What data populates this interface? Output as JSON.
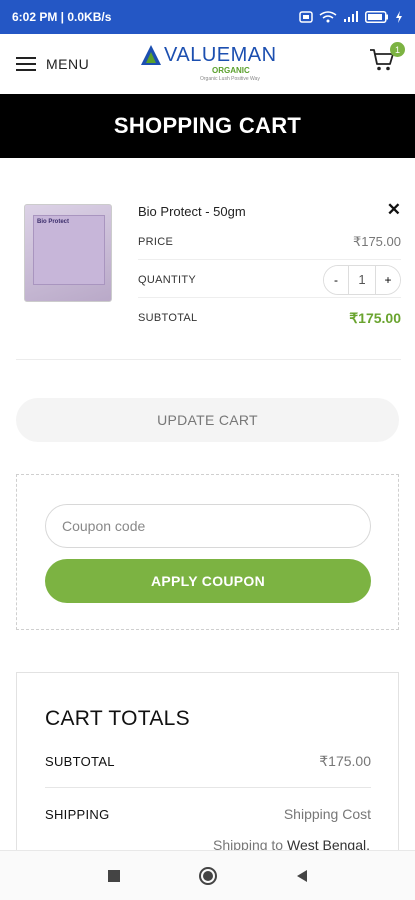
{
  "status_bar": {
    "time": "6:02 PM | 0.0KB/s",
    "icons": [
      "alarm-icon",
      "wifi-icon",
      "signal-icon",
      "battery-icon",
      "charging-icon"
    ],
    "battery": "81"
  },
  "header": {
    "menu_label": "MENU",
    "logo_text": "VALUEMAN",
    "logo_sub": "ORGANIC",
    "logo_tag": "Organic Lush Positive Way",
    "cart_count": "1"
  },
  "page_title": "SHOPPING CART",
  "cart_item": {
    "name": "Bio Protect - 50gm",
    "image_text": "Bio Protect",
    "price_label": "PRICE",
    "price": "₹175.00",
    "quantity_label": "QUANTITY",
    "qty_minus": "-",
    "qty_value": "1",
    "qty_plus": "+",
    "subtotal_label": "SUBTOTAL",
    "subtotal": "₹175.00",
    "remove": "✕"
  },
  "update_cart_label": "UPDATE CART",
  "coupon": {
    "placeholder": "Coupon code",
    "apply_label": "APPLY COUPON"
  },
  "cart_totals": {
    "title": "CART TOTALS",
    "subtotal_label": "SUBTOTAL",
    "subtotal": "₹175.00",
    "shipping_label": "SHIPPING",
    "shipping_value": "Shipping Cost",
    "shipping_to_prefix": "Shipping to",
    "shipping_to_place": "West Bengal."
  },
  "colors": {
    "status_bar": "#2457c5",
    "accent_green": "#7cb342",
    "title_band": "#000000"
  }
}
